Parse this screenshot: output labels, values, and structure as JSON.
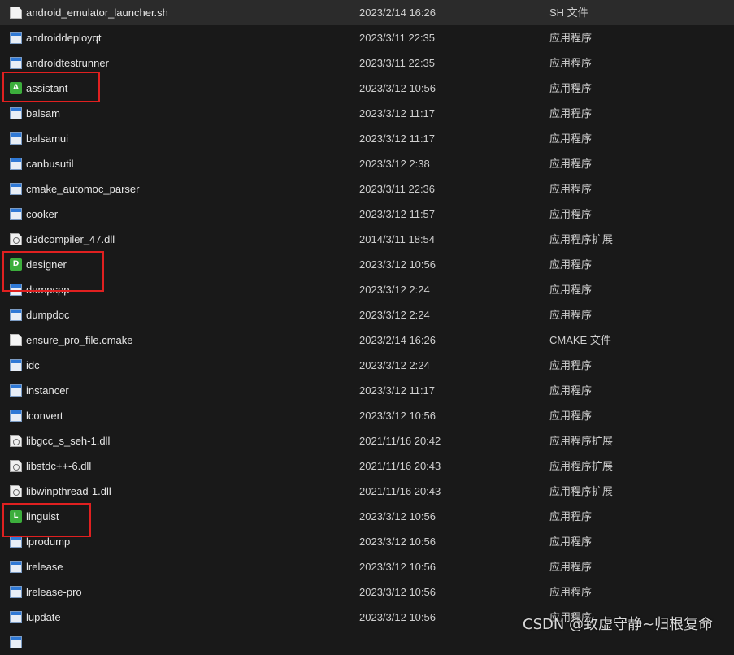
{
  "files": [
    {
      "name": "android_emulator_launcher.sh",
      "date": "2023/2/14 16:26",
      "type": "SH 文件",
      "icon": "file-icon",
      "selected": true
    },
    {
      "name": "androiddeployqt",
      "date": "2023/3/11 22:35",
      "type": "应用程序",
      "icon": "app-icon"
    },
    {
      "name": "androidtestrunner",
      "date": "2023/3/11 22:35",
      "type": "应用程序",
      "icon": "app-icon"
    },
    {
      "name": "assistant",
      "date": "2023/3/12 10:56",
      "type": "应用程序",
      "icon": "qt-assistant-icon",
      "glyph": "A"
    },
    {
      "name": "balsam",
      "date": "2023/3/12 11:17",
      "type": "应用程序",
      "icon": "app-icon"
    },
    {
      "name": "balsamui",
      "date": "2023/3/12 11:17",
      "type": "应用程序",
      "icon": "app-icon"
    },
    {
      "name": "canbusutil",
      "date": "2023/3/12 2:38",
      "type": "应用程序",
      "icon": "app-icon"
    },
    {
      "name": "cmake_automoc_parser",
      "date": "2023/3/11 22:36",
      "type": "应用程序",
      "icon": "app-icon"
    },
    {
      "name": "cooker",
      "date": "2023/3/12 11:57",
      "type": "应用程序",
      "icon": "app-icon"
    },
    {
      "name": "d3dcompiler_47.dll",
      "date": "2014/3/11 18:54",
      "type": "应用程序扩展",
      "icon": "dll-icon"
    },
    {
      "name": "designer",
      "date": "2023/3/12 10:56",
      "type": "应用程序",
      "icon": "qt-designer-icon",
      "glyph": "D"
    },
    {
      "name": "dumpcpp",
      "date": "2023/3/12 2:24",
      "type": "应用程序",
      "icon": "app-icon"
    },
    {
      "name": "dumpdoc",
      "date": "2023/3/12 2:24",
      "type": "应用程序",
      "icon": "app-icon"
    },
    {
      "name": "ensure_pro_file.cmake",
      "date": "2023/2/14 16:26",
      "type": "CMAKE 文件",
      "icon": "file-icon"
    },
    {
      "name": "idc",
      "date": "2023/3/12 2:24",
      "type": "应用程序",
      "icon": "app-icon"
    },
    {
      "name": "instancer",
      "date": "2023/3/12 11:17",
      "type": "应用程序",
      "icon": "app-icon"
    },
    {
      "name": "lconvert",
      "date": "2023/3/12 10:56",
      "type": "应用程序",
      "icon": "app-icon"
    },
    {
      "name": "libgcc_s_seh-1.dll",
      "date": "2021/11/16 20:42",
      "type": "应用程序扩展",
      "icon": "dll-icon"
    },
    {
      "name": "libstdc++-6.dll",
      "date": "2021/11/16 20:43",
      "type": "应用程序扩展",
      "icon": "dll-icon"
    },
    {
      "name": "libwinpthread-1.dll",
      "date": "2021/11/16 20:43",
      "type": "应用程序扩展",
      "icon": "dll-icon"
    },
    {
      "name": "linguist",
      "date": "2023/3/12 10:56",
      "type": "应用程序",
      "icon": "qt-linguist-icon",
      "glyph": "L"
    },
    {
      "name": "lprodump",
      "date": "2023/3/12 10:56",
      "type": "应用程序",
      "icon": "app-icon"
    },
    {
      "name": "lrelease",
      "date": "2023/3/12 10:56",
      "type": "应用程序",
      "icon": "app-icon"
    },
    {
      "name": "lrelease-pro",
      "date": "2023/3/12 10:56",
      "type": "应用程序",
      "icon": "app-icon"
    },
    {
      "name": "lupdate",
      "date": "2023/3/12 10:56",
      "type": "应用程序",
      "icon": "app-icon"
    },
    {
      "name": "",
      "date": "",
      "type": "",
      "icon": "app-icon"
    }
  ],
  "watermark": "CSDN @致虚守静~归根复命",
  "colors": {
    "highlight": "#e02020",
    "qt_green": "#3cae3c",
    "background": "#191919"
  }
}
